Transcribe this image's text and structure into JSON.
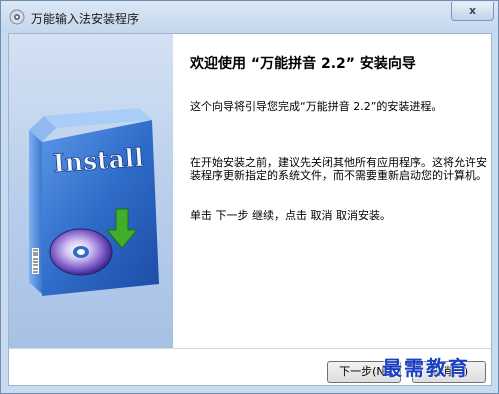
{
  "window": {
    "title": "万能输入法安装程序",
    "close_glyph": "x"
  },
  "welcome": {
    "heading": "欢迎使用 “万能拼音 2.2” 安装向导",
    "intro": "这个向导将引导您完成“万能拼音 2.2”的安装进程。",
    "advice": "在开始安装之前，建议先关闭其他所有应用程序。这将允许安装程序更新指定的系统文件，而不需要重新启动您的计算机。",
    "instruction": "单击 下一步 继续，点击 取消 取消安装。"
  },
  "box_art": {
    "label": "Install"
  },
  "buttons": {
    "next": "下一步(N)",
    "cancel": "取消(C)"
  },
  "watermark": "最需教育",
  "colors": {
    "titlebar": "#c5d7ee",
    "side_panel": "#bcd0ec",
    "box_blue": "#2f6cc9",
    "arrow_green": "#3fae2a",
    "watermark": "#1a3fc0"
  }
}
